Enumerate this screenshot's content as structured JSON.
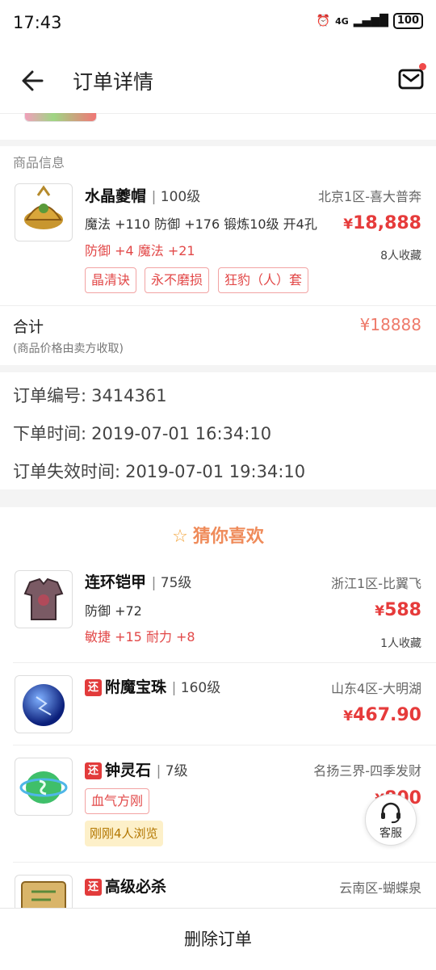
{
  "status": {
    "time": "17:43",
    "signal": "4G",
    "battery": "100"
  },
  "header": {
    "title": "订单详情"
  },
  "goods_section": {
    "label": "商品信息"
  },
  "main_item": {
    "name": "水晶夔帽",
    "level": "100级",
    "server": "北京1区-喜大普奔",
    "attrs": "魔法 +110 防御 +176 锻炼10级 开4孔",
    "bonus": "防御 +4 魔法 +21",
    "price": "18,888",
    "favorites": "8人收藏",
    "tags": [
      "晶清诀",
      "永不磨损",
      "狂豹（人）套"
    ]
  },
  "total": {
    "label": "合计",
    "note": "(商品价格由卖方收取)",
    "value": "¥18888"
  },
  "order": {
    "id_label": "订单编号:",
    "id": "3414361",
    "time_label": "下单时间:",
    "time": "2019-07-01 16:34:10",
    "expire_label": "订单失效时间:",
    "expire": "2019-07-01 19:34:10"
  },
  "recommend": {
    "title": "猜你喜欢",
    "items": [
      {
        "name": "连环铠甲",
        "level": "75级",
        "server": "浙江1区-比翼飞",
        "attrs": "防御 +72",
        "bonus": "敏捷 +15 耐力 +8",
        "price": "588",
        "favorites": "1人收藏"
      },
      {
        "badge": "还",
        "name": "附魔宝珠",
        "level": "160级",
        "server": "山东4区-大明湖",
        "price": "467.90"
      },
      {
        "badge": "还",
        "name": "钟灵石",
        "level": "7级",
        "server": "名扬三界-四季发财",
        "tag": "血气方刚",
        "hot": "刚刚4人浏览",
        "price": "800"
      },
      {
        "badge": "还",
        "name": "高级必杀",
        "server": "云南区-蝴蝶泉"
      }
    ]
  },
  "customer_service": {
    "label": "客服"
  },
  "bottom": {
    "delete_label": "删除订单"
  },
  "colors": {
    "price_red": "#e63b3b",
    "accent_orange": "#ef8b5a"
  }
}
